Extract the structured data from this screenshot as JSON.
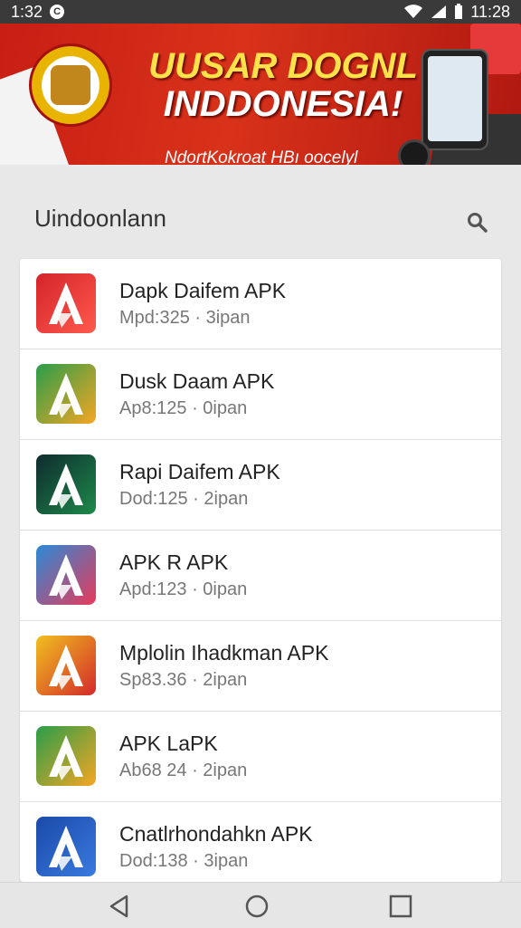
{
  "status_bar": {
    "time_left": "1:32",
    "time_right": "11:28",
    "notification_badge": "C"
  },
  "banner": {
    "title_line1": "UUSAR DOGNL",
    "title_line2": "INDDONESIA!",
    "subtitle": "NdortKokroat HBı oocelyl"
  },
  "search": {
    "value": "Uindoonlann"
  },
  "apps": [
    {
      "title": "Dapk Daifem APK",
      "meta": "Mpd:325 · 3ipan",
      "icon": "app-icon-red-a",
      "colors": [
        "#d4232a",
        "#ff5a4d"
      ]
    },
    {
      "title": "Dusk Daam APK",
      "meta": "Ap8:125 · 0ipan",
      "icon": "app-icon-multicolor-a",
      "colors": [
        "#2a9d4a",
        "#f5a623"
      ]
    },
    {
      "title": "Rapi Daifem APK",
      "meta": "Dod:125 · 2ipan",
      "icon": "app-icon-dark-green-a",
      "colors": [
        "#0f2a2e",
        "#1d8a4a"
      ]
    },
    {
      "title": "APK R APK",
      "meta": "Apd:123 · 0ipan",
      "icon": "app-icon-blue-red-a",
      "colors": [
        "#2a8ad6",
        "#e83a5a"
      ]
    },
    {
      "title": "Mplolin Ihadkman APK",
      "meta": "Sp83.36 · 2ipan",
      "icon": "app-icon-colorful-a",
      "colors": [
        "#f0c020",
        "#d42a2a"
      ]
    },
    {
      "title": "APK LaPK",
      "meta": "Ab68 24 · 2ipan",
      "icon": "app-icon-green-orange-a",
      "colors": [
        "#2a9d4a",
        "#f5a623"
      ]
    },
    {
      "title": "Cnatlrhondahkn APK",
      "meta": "Dod:138 · 3ipan",
      "icon": "app-icon-blue-a",
      "colors": [
        "#1a4aa8",
        "#3a7ae0"
      ]
    }
  ]
}
